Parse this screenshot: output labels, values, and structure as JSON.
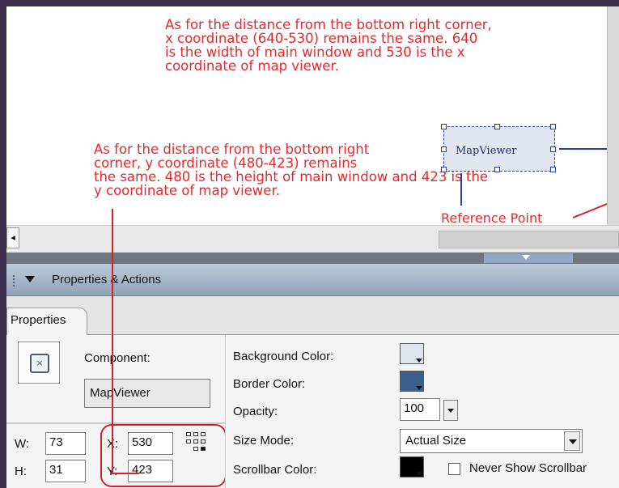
{
  "stage": {
    "annotation_top": "As for the distance from the bottom right corner,\nx coordinate (640-530) remains the same. 640\nis the width of main window and 530 is the x\ncoordinate of map viewer.",
    "annotation_left": "As for the distance from the bottom right\ncorner, y coordinate (480-423) remains\nthe same. 480 is the height of main window and 423 is the\ny coordinate of map viewer.",
    "component_label": "MapViewer",
    "reference_label": "Reference Point"
  },
  "hscroll": {
    "left_button": "◂"
  },
  "panel": {
    "title": "Properties & Actions"
  },
  "tabs": [
    {
      "label": "Properties"
    }
  ],
  "properties": {
    "component_label": "Component:",
    "component_name": "MapViewer",
    "w_label": "W:",
    "w_value": "73",
    "h_label": "H:",
    "h_value": "31",
    "x_label": "X:",
    "x_value": "530",
    "y_label": "Y:",
    "y_value": "423",
    "background_color_label": "Background Color:",
    "border_color_label": "Border Color:",
    "opacity_label": "Opacity:",
    "opacity_value": "100",
    "size_mode_label": "Size Mode:",
    "size_mode_value": "Actual Size",
    "scrollbar_color_label": "Scrollbar Color:",
    "never_show_scrollbar_label": "Never Show Scrollbar",
    "never_show_scrollbar_checked": false
  },
  "colors": {
    "annotation": "#e8282d",
    "background_swatch": "#dde4ee",
    "border_swatch": "#3b5f8a",
    "scrollbar_swatch": "#000000",
    "panel_header": "#a9b9ca"
  },
  "icons": {
    "component_icon": "component-icon",
    "collapse": "triangle-down-icon",
    "registration": "registration-point-icon"
  }
}
